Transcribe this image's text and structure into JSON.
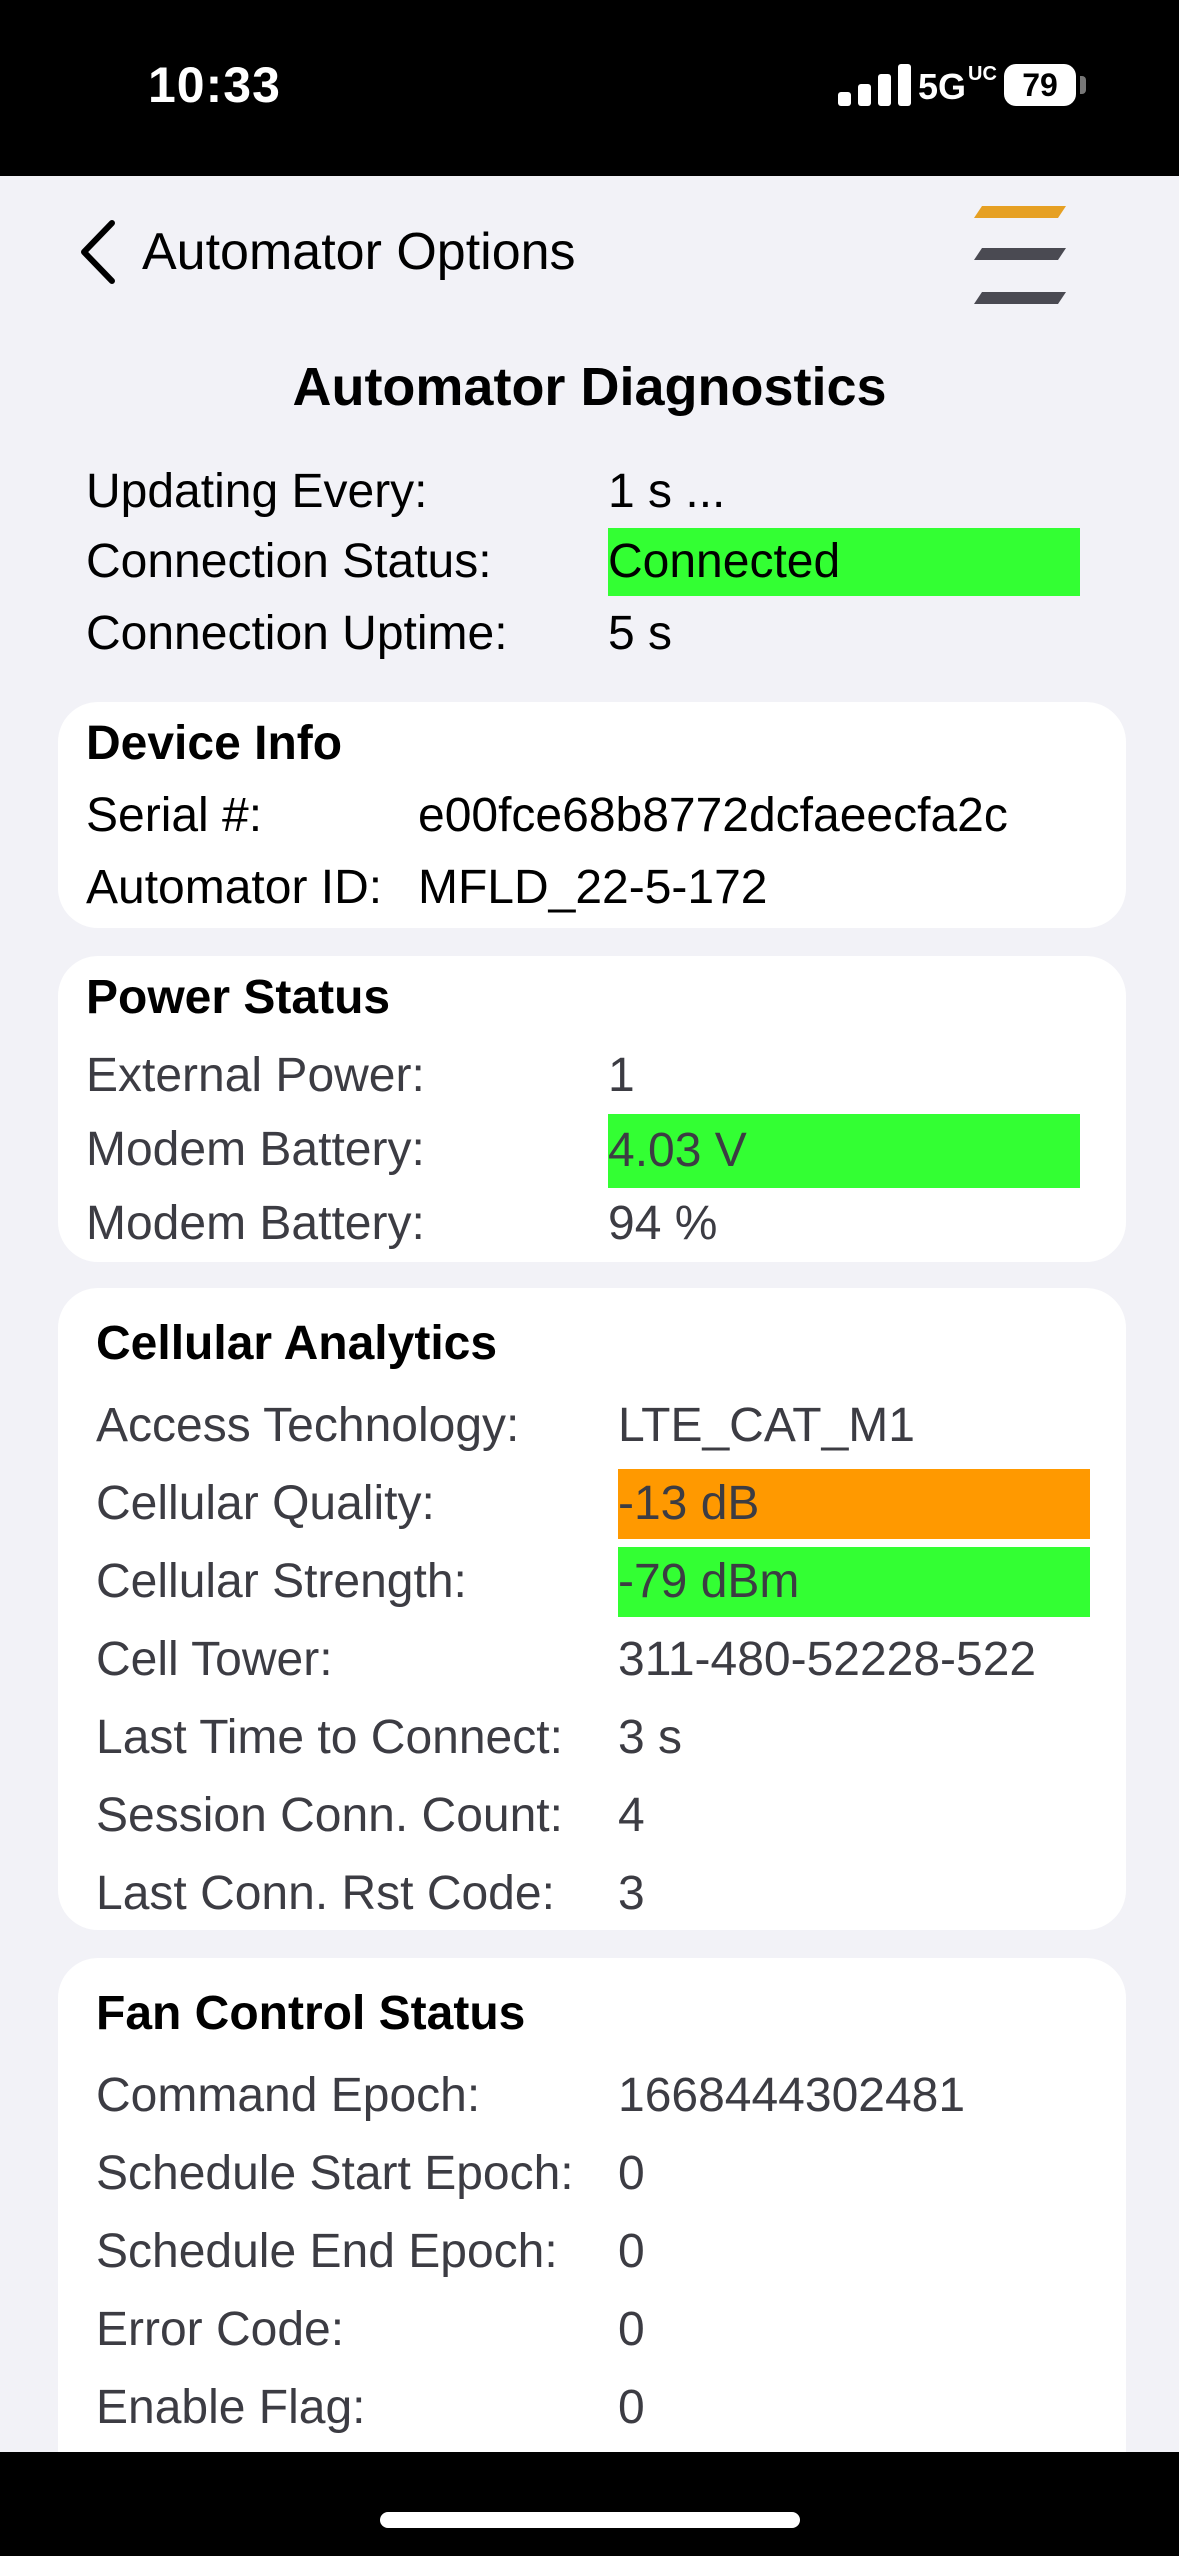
{
  "status_bar": {
    "time": "10:33",
    "network": "5G",
    "network_suffix": "UC",
    "battery": "79",
    "icons": [
      "signal-bars-icon",
      "battery-icon"
    ]
  },
  "nav": {
    "back_label": "Automator Options",
    "icons": [
      "chevron-left-icon",
      "app-logo-icon"
    ]
  },
  "page_title": "Automator Diagnostics",
  "summary": {
    "updating_label": "Updating Every:",
    "updating_value": "1 s ...",
    "connection_status_label": "Connection Status:",
    "connection_status_value": "Connected",
    "uptime_label": "Connection Uptime:",
    "uptime_value": "5 s"
  },
  "device_info": {
    "title": "Device Info",
    "serial_label": "Serial #:",
    "serial_value": "e00fce68b8772dcfaeecfa2c",
    "automator_id_label": "Automator ID:",
    "automator_id_value": "MFLD_22-5-172"
  },
  "power_status": {
    "title": "Power Status",
    "external_power_label": "External Power:",
    "external_power_value": "1",
    "modem_battery_v_label": "Modem Battery:",
    "modem_battery_v_value": "4.03 V",
    "modem_battery_pct_label": "Modem Battery:",
    "modem_battery_pct_value": "94 %"
  },
  "cellular": {
    "title": "Cellular Analytics",
    "rows": [
      {
        "label": "Access Technology:",
        "value": "LTE_CAT_M1"
      },
      {
        "label": "Cellular Quality:",
        "value": "-13 dB"
      },
      {
        "label": "Cellular Strength:",
        "value": "-79 dBm"
      },
      {
        "label": "Cell Tower:",
        "value": "311-480-52228-522"
      },
      {
        "label": "Last Time to Connect:",
        "value": "3 s"
      },
      {
        "label": "Session Conn. Count:",
        "value": "4"
      },
      {
        "label": "Last Conn. Rst Code:",
        "value": "3"
      }
    ]
  },
  "fan_control": {
    "title": "Fan Control Status",
    "rows": [
      {
        "label": "Command Epoch:",
        "value": "1668444302481"
      },
      {
        "label": "Schedule Start Epoch:",
        "value": "0"
      },
      {
        "label": "Schedule End Epoch:",
        "value": "0"
      },
      {
        "label": "Error Code:",
        "value": "0"
      },
      {
        "label": "Enable Flag:",
        "value": "0"
      }
    ]
  },
  "colors": {
    "good": "#33ff33",
    "warning": "#ff9900",
    "logo_orange": "#e6a023",
    "logo_gray": "#4a4a52"
  }
}
